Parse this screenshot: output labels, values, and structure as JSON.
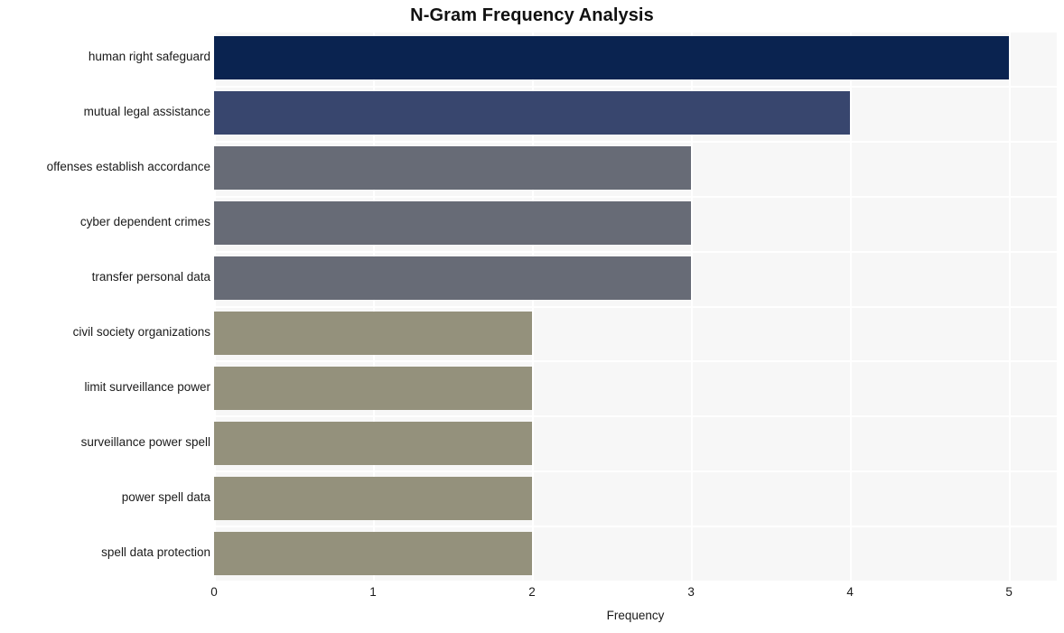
{
  "chart_data": {
    "type": "bar",
    "orientation": "horizontal",
    "title": "N-Gram Frequency Analysis",
    "xlabel": "Frequency",
    "ylabel": "",
    "categories": [
      "human right safeguard",
      "mutual legal assistance",
      "offenses establish accordance",
      "cyber dependent crimes",
      "transfer personal data",
      "civil society organizations",
      "limit surveillance power",
      "surveillance power spell",
      "power spell data",
      "spell data protection"
    ],
    "values": [
      5,
      4,
      3,
      3,
      3,
      2,
      2,
      2,
      2,
      2
    ],
    "bar_colors": [
      "#0a2350",
      "#38466e",
      "#676b76",
      "#676b76",
      "#676b76",
      "#94917c",
      "#94917c",
      "#94917c",
      "#94917c",
      "#94917c"
    ],
    "xlim": [
      0,
      5.3
    ],
    "xticks": [
      "0",
      "1",
      "2",
      "3",
      "4",
      "5"
    ],
    "xtick_values": [
      0,
      1,
      2,
      3,
      4,
      5
    ],
    "grid": true,
    "grid_color": "#ffffff",
    "plot_background": "#f7f7f7",
    "figure_background": "#ffffff",
    "legend": null
  }
}
